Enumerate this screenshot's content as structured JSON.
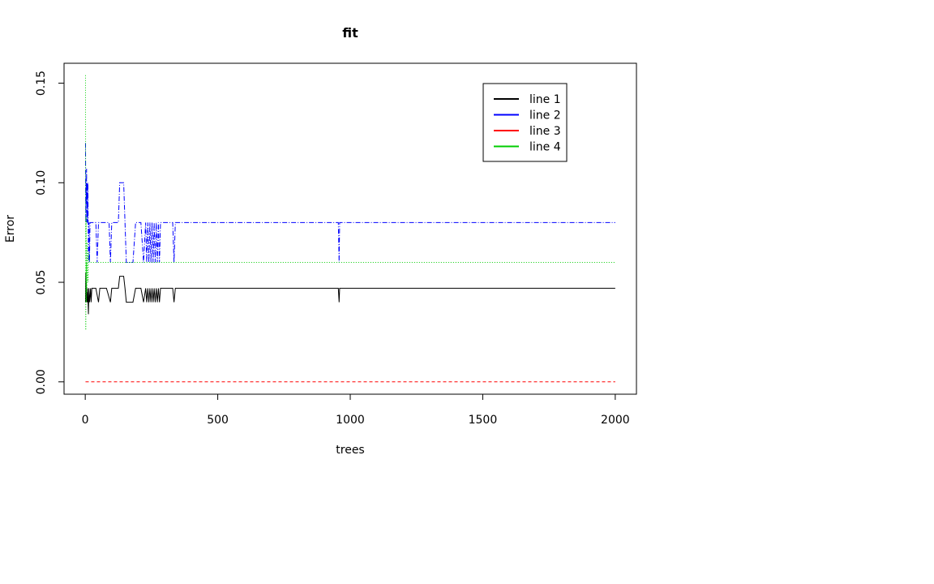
{
  "chart_data": {
    "type": "line",
    "title": "fit",
    "xlabel": "trees",
    "ylabel": "Error",
    "xlim": [
      -80,
      2080
    ],
    "ylim": [
      -0.0062,
      0.16
    ],
    "xticks": [
      0,
      500,
      1000,
      1500,
      2000
    ],
    "xtick_labels": [
      "0",
      "500",
      "1000",
      "1500",
      "2000"
    ],
    "yticks": [
      0.0,
      0.05,
      0.1,
      0.15
    ],
    "ytick_labels": [
      "0.00",
      "0.05",
      "0.10",
      "0.15"
    ],
    "grid": false,
    "legend_position": "top-right",
    "series": [
      {
        "name": "line 1",
        "color": "#000000",
        "dash": "solid",
        "x": [
          1,
          2,
          3,
          4,
          5,
          6,
          7,
          8,
          9,
          10,
          12,
          14,
          16,
          18,
          20,
          22,
          25,
          30,
          40,
          50,
          55,
          60,
          80,
          95,
          100,
          105,
          125,
          130,
          135,
          140,
          145,
          150,
          155,
          160,
          170,
          180,
          190,
          200,
          210,
          220,
          228,
          232,
          236,
          240,
          244,
          248,
          252,
          256,
          260,
          264,
          268,
          272,
          276,
          280,
          284,
          288,
          330,
          335,
          340,
          955,
          958,
          960,
          965,
          2000
        ],
        "y": [
          0.04,
          0.055,
          0.048,
          0.05,
          0.043,
          0.04,
          0.045,
          0.04,
          0.047,
          0.043,
          0.034,
          0.047,
          0.04,
          0.043,
          0.047,
          0.04,
          0.047,
          0.047,
          0.047,
          0.04,
          0.047,
          0.047,
          0.047,
          0.04,
          0.047,
          0.047,
          0.047,
          0.053,
          0.053,
          0.053,
          0.053,
          0.047,
          0.04,
          0.04,
          0.04,
          0.04,
          0.047,
          0.047,
          0.047,
          0.04,
          0.047,
          0.04,
          0.047,
          0.04,
          0.047,
          0.04,
          0.047,
          0.04,
          0.047,
          0.04,
          0.047,
          0.04,
          0.047,
          0.04,
          0.047,
          0.047,
          0.047,
          0.04,
          0.047,
          0.047,
          0.04,
          0.047,
          0.047,
          0.047
        ]
      },
      {
        "name": "line 2",
        "color": "#0000ff",
        "dash": "dashdot",
        "x": [
          1,
          2,
          3,
          4,
          5,
          6,
          7,
          8,
          9,
          10,
          12,
          14,
          16,
          18,
          20,
          30,
          40,
          45,
          50,
          55,
          60,
          90,
          95,
          100,
          105,
          125,
          130,
          135,
          140,
          145,
          150,
          155,
          160,
          170,
          180,
          190,
          200,
          210,
          220,
          228,
          232,
          236,
          240,
          244,
          248,
          252,
          256,
          260,
          264,
          268,
          272,
          276,
          280,
          284,
          288,
          330,
          335,
          340,
          955,
          958,
          960,
          965,
          2000
        ],
        "y": [
          0.12,
          0.08,
          0.1,
          0.09,
          0.107,
          0.08,
          0.1,
          0.09,
          0.08,
          0.1,
          0.06,
          0.08,
          0.06,
          0.08,
          0.08,
          0.08,
          0.08,
          0.06,
          0.08,
          0.08,
          0.08,
          0.08,
          0.06,
          0.08,
          0.08,
          0.08,
          0.1,
          0.1,
          0.1,
          0.1,
          0.08,
          0.06,
          0.06,
          0.06,
          0.06,
          0.08,
          0.08,
          0.08,
          0.06,
          0.08,
          0.06,
          0.08,
          0.06,
          0.08,
          0.06,
          0.08,
          0.06,
          0.08,
          0.06,
          0.08,
          0.06,
          0.08,
          0.06,
          0.08,
          0.08,
          0.08,
          0.06,
          0.08,
          0.08,
          0.06,
          0.08,
          0.08,
          0.08
        ]
      },
      {
        "name": "line 3",
        "color": "#ff0000",
        "dash": "dashed",
        "x": [
          1,
          2000
        ],
        "y": [
          0.0,
          0.0
        ]
      },
      {
        "name": "line 4",
        "color": "#00cd00",
        "dash": "dotted",
        "x": [
          1,
          2,
          3,
          4,
          5,
          6,
          7,
          8,
          10,
          12,
          15,
          20,
          25,
          30,
          40,
          2000
        ],
        "y": [
          0.154,
          0.026,
          0.083,
          0.04,
          0.06,
          0.045,
          0.07,
          0.06,
          0.05,
          0.065,
          0.06,
          0.06,
          0.06,
          0.06,
          0.06,
          0.06
        ]
      }
    ]
  }
}
